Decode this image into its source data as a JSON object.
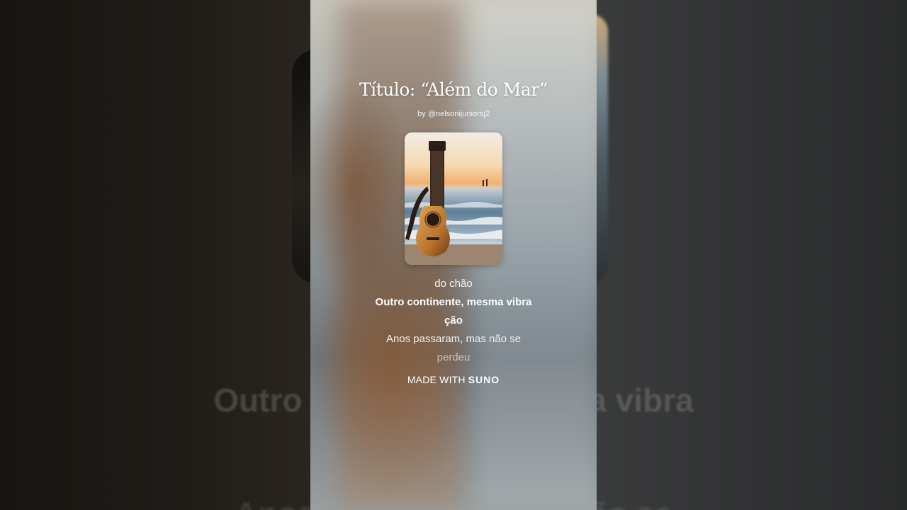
{
  "card": {
    "title": "Título: “Além do Mar”",
    "byline": "by @nelsonijuniorsj2",
    "cover_description_icon": "cover-art-guitar-beach"
  },
  "lyrics": {
    "previous": "do chão",
    "current_line_1": "Outro continente, mesma vibra",
    "current_line_2": "ção",
    "next_line_1": "Anos passaram, mas não se",
    "next_line_2": "perdeu"
  },
  "branding": {
    "prefix": "MADE WITH",
    "brand": "SUNO"
  },
  "background": {
    "ghost_current": "Outro continente, mesma vibra",
    "ghost_next": "Anos passaram, mas não se"
  },
  "colors": {
    "text": "#ffffff",
    "page_bg": "#1b1a18"
  }
}
